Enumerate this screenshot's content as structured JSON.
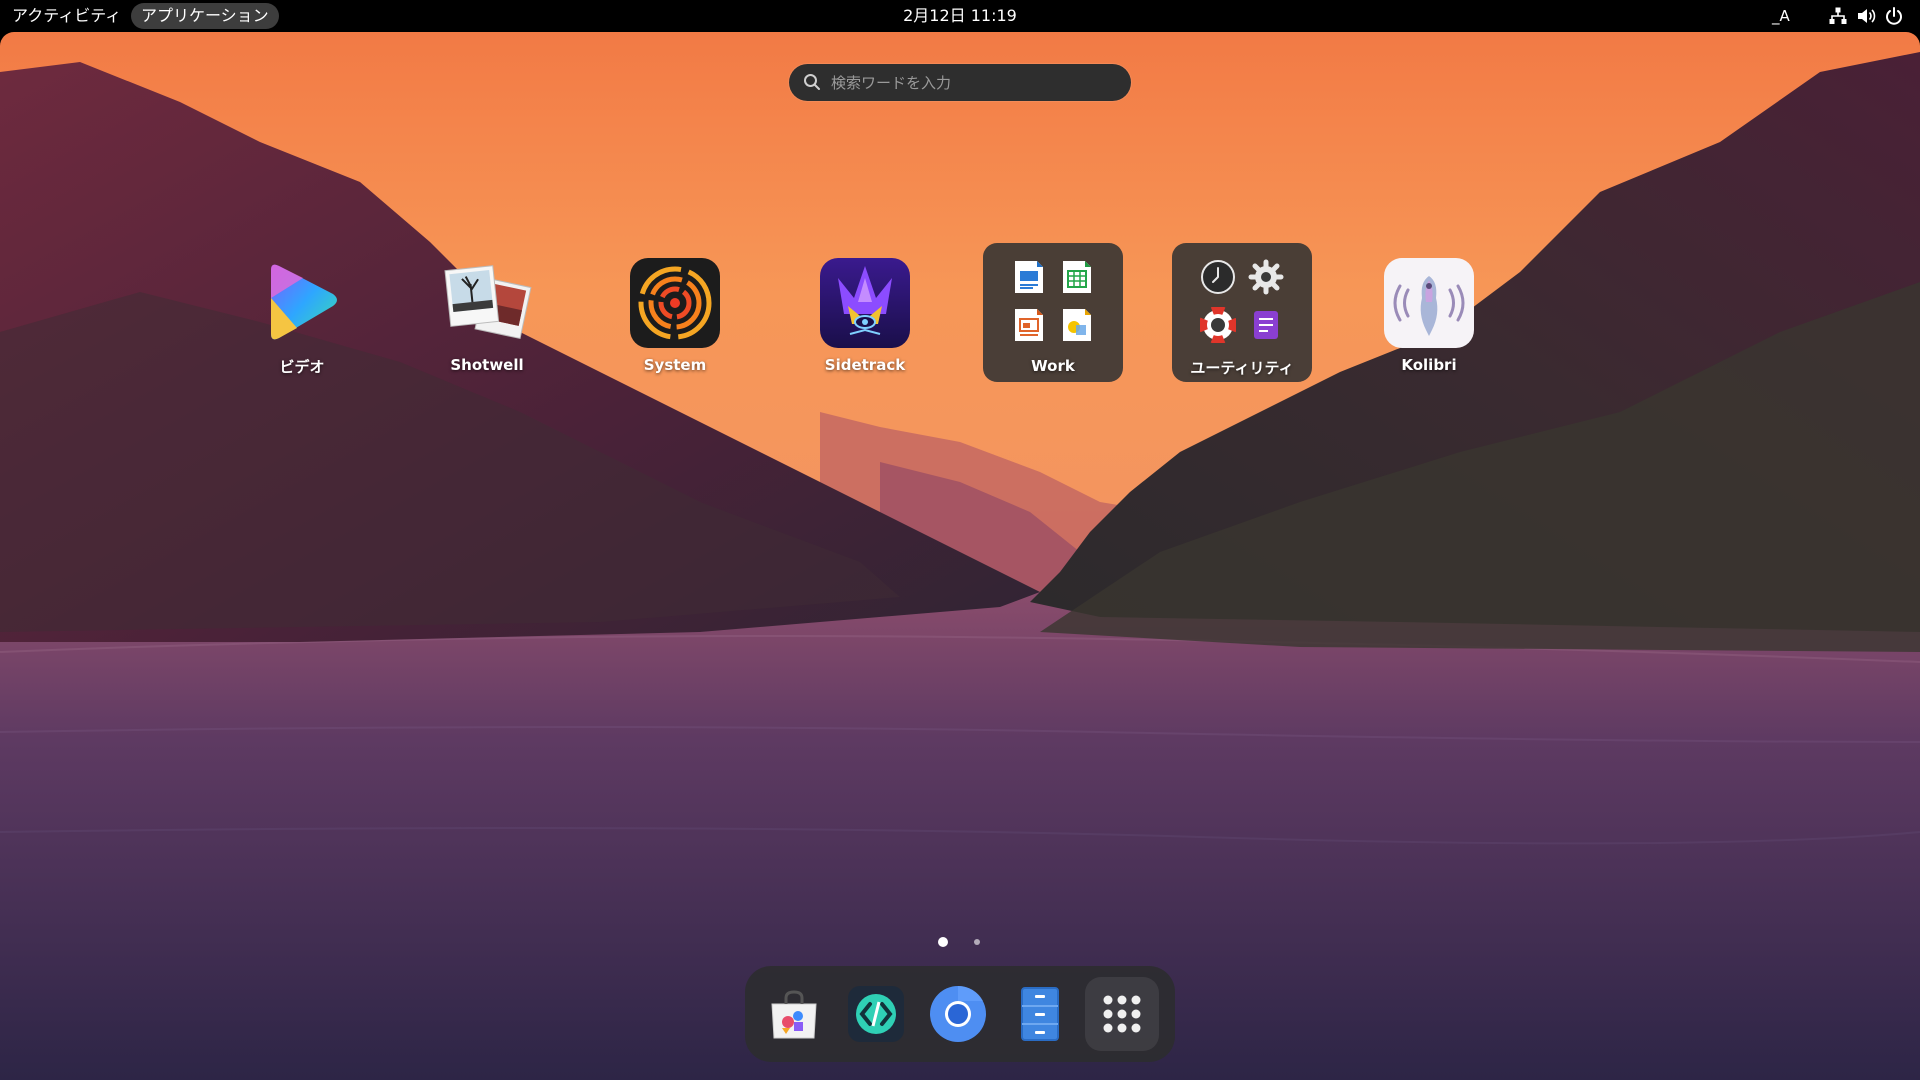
{
  "topbar": {
    "activities_label": "アクティビティ",
    "apps_menu_label": "アプリケーション",
    "clock": "2月12日  11:19",
    "input_method": "_A",
    "tray_icons": [
      "network-icon",
      "volume-icon",
      "power-icon"
    ]
  },
  "search": {
    "placeholder": "検索ワードを入力"
  },
  "apps": [
    {
      "label": "ビデオ",
      "icon": "videos-icon"
    },
    {
      "label": "Shotwell",
      "icon": "shotwell-icon"
    },
    {
      "label": "System",
      "icon": "system-icon"
    },
    {
      "label": "Sidetrack",
      "icon": "sidetrack-icon"
    },
    {
      "label": "Work",
      "icon": "work-folder-icon",
      "folder": true
    },
    {
      "label": "ユーティリティ",
      "icon": "utilities-folder-icon",
      "folder": true
    },
    {
      "label": "Kolibri",
      "icon": "kolibri-icon"
    }
  ],
  "pagination": {
    "current_page": 1,
    "total_pages": 2
  },
  "dock": {
    "items": [
      "software-store-icon",
      "code-editor-icon",
      "chromium-icon",
      "files-icon",
      "show-apps-icon"
    ]
  }
}
